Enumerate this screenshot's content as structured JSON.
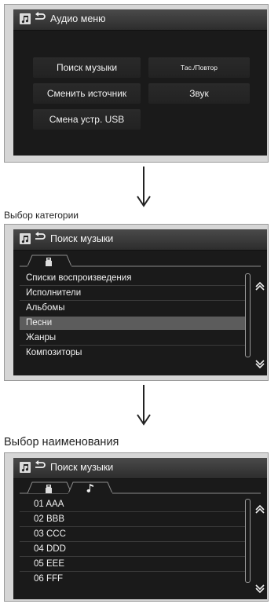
{
  "screen1": {
    "title": "Аудио меню",
    "buttons": {
      "search_music": "Поиск музыки",
      "change_source": "Сменить источник",
      "change_usb": "Смена устр. USB",
      "shuffle_repeat": "Тас./Повтор",
      "sound": "Звук"
    }
  },
  "caption1": "Выбор категории",
  "screen2": {
    "title": "Поиск музыки",
    "items": [
      "Списки воспроизведения",
      "Исполнители",
      "Альбомы",
      "Песни",
      "Жанры",
      "Композиторы"
    ],
    "selected_index": 3
  },
  "caption2": "Выбор наименования",
  "screen3": {
    "title": "Поиск музыки",
    "items": [
      "01 AAA",
      "02 BBB",
      "03 CCC",
      "04 DDD",
      "05 EEE",
      "06 FFF"
    ]
  },
  "icons": {
    "title_icon": "music-folder-icon",
    "back": "back-arrow-icon",
    "usb_tab": "usb-icon",
    "note_tab": "music-note-icon",
    "scroll_up": "chevron-up-icon",
    "scroll_down": "chevron-down-icon",
    "flow_arrow": "arrow-down-icon"
  },
  "colors": {
    "screen_bg": "#1a1a1a",
    "selected_row": "#5c5c5c",
    "panel_bg": "#d6d6d6"
  }
}
